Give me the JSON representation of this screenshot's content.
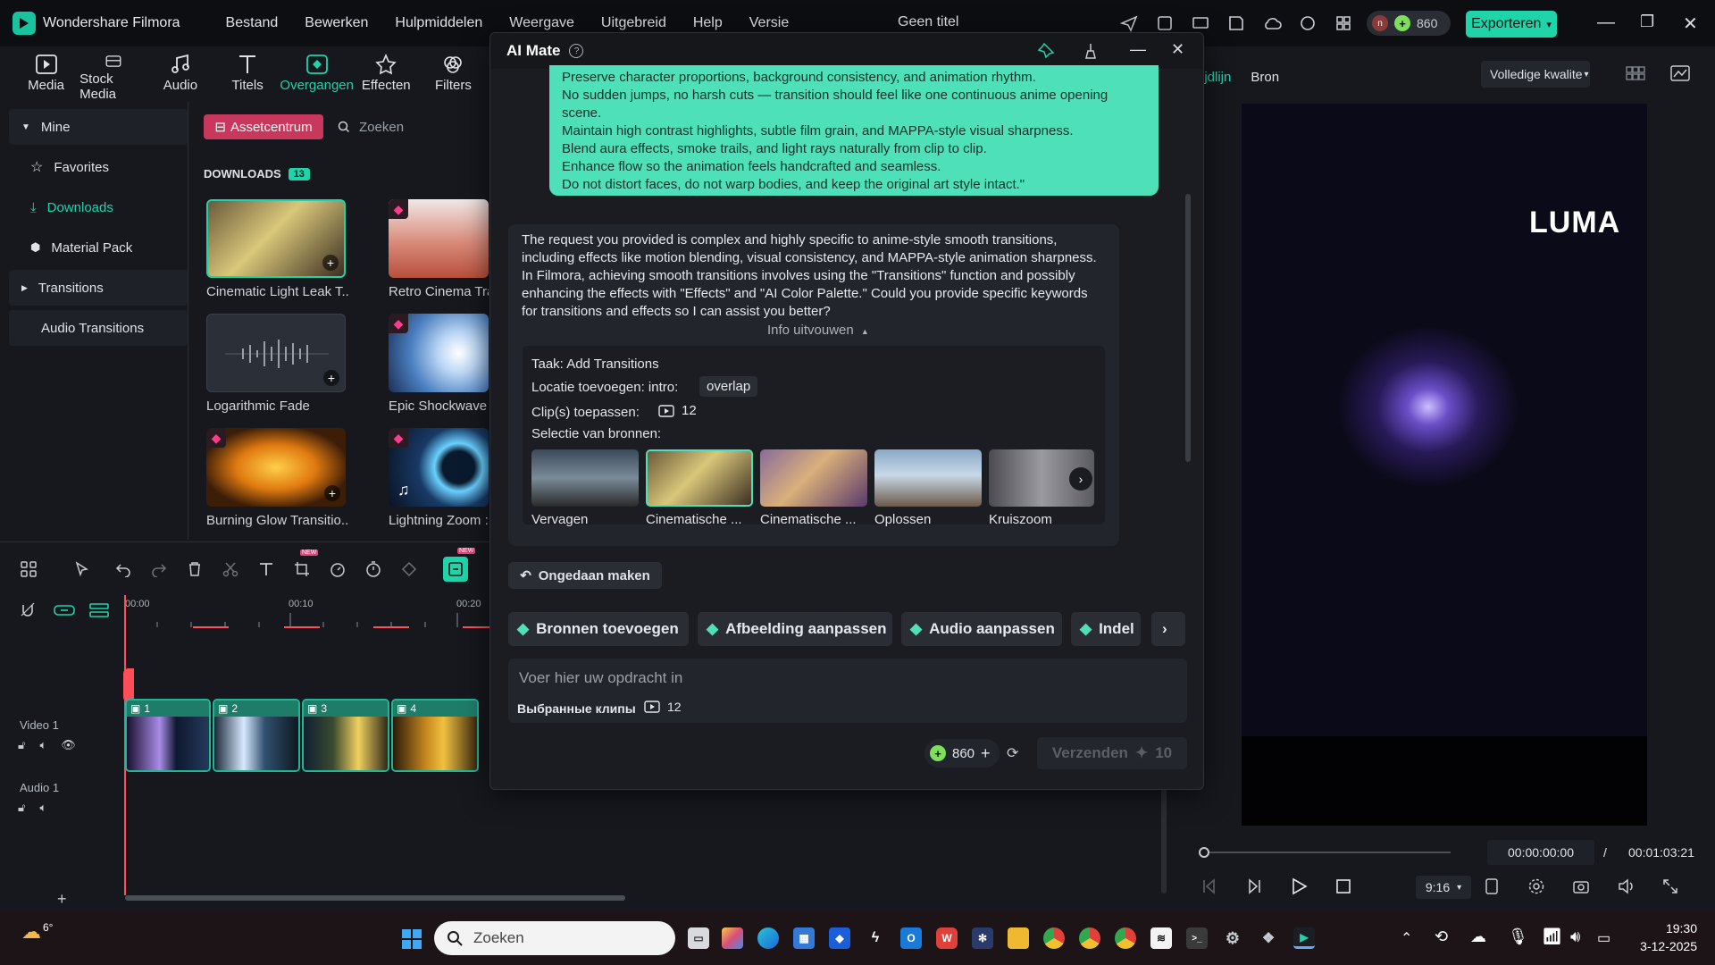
{
  "app": {
    "name": "Wondershare Filmora",
    "doc_title": "Geen titel",
    "credits": "860",
    "export_label": "Exporteren",
    "avatar_letter": "n"
  },
  "menu": [
    "Bestand",
    "Bewerken",
    "Hulpmiddelen",
    "Weergave",
    "Uitgebreid",
    "Help",
    "Versie"
  ],
  "toolbar": [
    "Media",
    "Stock Media",
    "Audio",
    "Titels",
    "Overgangen",
    "Effecten",
    "Filters"
  ],
  "sidebar": {
    "mine": "Mine",
    "favorites": "Favorites",
    "downloads": "Downloads",
    "material_pack": "Material Pack",
    "transitions": "Transitions",
    "audio_transitions": "Audio Transitions"
  },
  "media": {
    "asset_center": "Assetcentrum",
    "search_placeholder": "Zoeken",
    "downloads_header": "DOWNLOADS",
    "downloads_count": "13",
    "items": [
      "Cinematic Light Leak T...",
      "Retro Cinema Tra",
      "Logarithmic Fade",
      "Epic Shockwave I",
      "Burning Glow Transitio...",
      "Lightning Zoom :"
    ]
  },
  "timeline": {
    "ticks": [
      "00:00",
      "00:10",
      "00:20"
    ],
    "video_track": "Video 1",
    "audio_track": "Audio 1",
    "clip_numbers": [
      "1",
      "2",
      "3",
      "4"
    ],
    "new_badge": "NEW"
  },
  "preview": {
    "tab_timeline": "ijdlijn",
    "tab_source": "Bron",
    "quality": "Volledige kwalite",
    "overlay_text": "LUMA",
    "time_current": "00:00:00:00",
    "time_sep": "/",
    "time_total": "00:01:03:21",
    "aspect": "9:16"
  },
  "ai_mate": {
    "title": "AI Mate",
    "user_message_lines": [
      "Preserve character proportions, background consistency, and animation rhythm.",
      "No sudden jumps, no harsh cuts — transition should feel like one continuous anime opening",
      "scene.",
      "Maintain high contrast highlights, subtle film grain, and MAPPA-style visual sharpness.",
      "Blend aura effects, smoke trails, and light rays naturally from clip to clip.",
      "Enhance flow so the animation feels handcrafted and seamless.",
      "Do not distort faces, do not warp bodies, and keep the original art style intact.\""
    ],
    "bot_reply": "The request you provided is complex and highly specific to anime-style smooth transitions, including effects like motion blending, visual consistency, and MAPPA-style animation sharpness. In Filmora, achieving smooth transitions involves using the \"Transitions\" function and possibly enhancing the effects with \"Effects\" and \"AI Color Palette.\" Could you provide specific keywords for transitions and effects so I can assist you better?",
    "info_expand": "Info uitvouwen",
    "task_label": "Taak: Add Transitions",
    "location_label": "Locatie toevoegen: intro:",
    "location_value": "overlap",
    "clips_label": "Clip(s) toepassen:",
    "clips_value": "12",
    "sources_label": "Selectie van bronnen:",
    "sources": [
      "Vervagen",
      "Cinematische ...",
      "Cinematische ...",
      "Oplossen",
      "Kruiszoom"
    ],
    "undo": "Ongedaan maken",
    "chips": [
      "Bronnen toevoegen",
      "Afbeelding aanpassen",
      "Audio aanpassen",
      "Indel"
    ],
    "prompt_placeholder": "Voer hier uw opdracht in",
    "selected_clips_label": "Выбранные клипы",
    "selected_clips_value": "12",
    "credits": "860",
    "send_label": "Verzenden",
    "send_cost": "10"
  },
  "taskbar": {
    "weather": "6°",
    "search_placeholder": "Zoeken",
    "time": "19:30",
    "date": "3-12-2025"
  },
  "colors": {
    "accent": "#1ed4a8",
    "asset_pink": "#c8385c",
    "playhead": "#ff4d5a"
  }
}
